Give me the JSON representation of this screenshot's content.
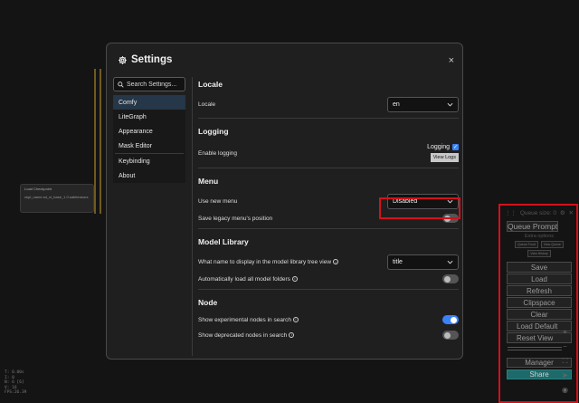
{
  "background": {
    "node_title": "Load Checkpoint",
    "node_field": "ckpt_name  sd_xl_base_1.0.safetensors",
    "stats": [
      "T: 0.00s",
      "I: 0",
      "N: 6 [6]",
      "V: 16",
      "FPS:26.39"
    ]
  },
  "dialog": {
    "title": "Settings",
    "close": "×",
    "search_placeholder": "Search Settings...",
    "categories": [
      "Comfy",
      "LiteGraph",
      "Appearance",
      "Mask Editor",
      "Keybinding",
      "About"
    ],
    "active_category": "Comfy"
  },
  "sections": {
    "locale": {
      "title": "Locale",
      "label": "Locale",
      "value": "en"
    },
    "logging": {
      "title": "Logging",
      "label": "Enable logging",
      "checkbox_label": "Logging",
      "view_logs": "View Logs"
    },
    "menu": {
      "title": "Menu",
      "use_new_menu_label": "Use new menu",
      "use_new_menu_value": "Disabled",
      "save_legacy_label": "Save legacy menu's position"
    },
    "model_library": {
      "title": "Model Library",
      "name_label": "What name to display in the model library tree view",
      "name_value": "title",
      "autoload_label": "Automatically load all model folders"
    },
    "node": {
      "title": "Node",
      "experimental_label": "Show experimental nodes in search",
      "deprecated_label": "Show deprecated nodes in search"
    }
  },
  "queue": {
    "size_label": "Queue size: 0",
    "queue_prompt": "Queue Prompt",
    "extra_options": "Extra options",
    "queue_front": "Queue Front",
    "view_queue": "View Queue",
    "view_history": "View History",
    "buttons": [
      "Save",
      "Load",
      "Refresh",
      "Clipspace",
      "Clear",
      "Load Default",
      "Reset View"
    ],
    "manager": "Manager",
    "share": "Share"
  },
  "colors": {
    "accent": "#3b82f6",
    "highlight": "#d3111b",
    "active_item": "#253748"
  }
}
